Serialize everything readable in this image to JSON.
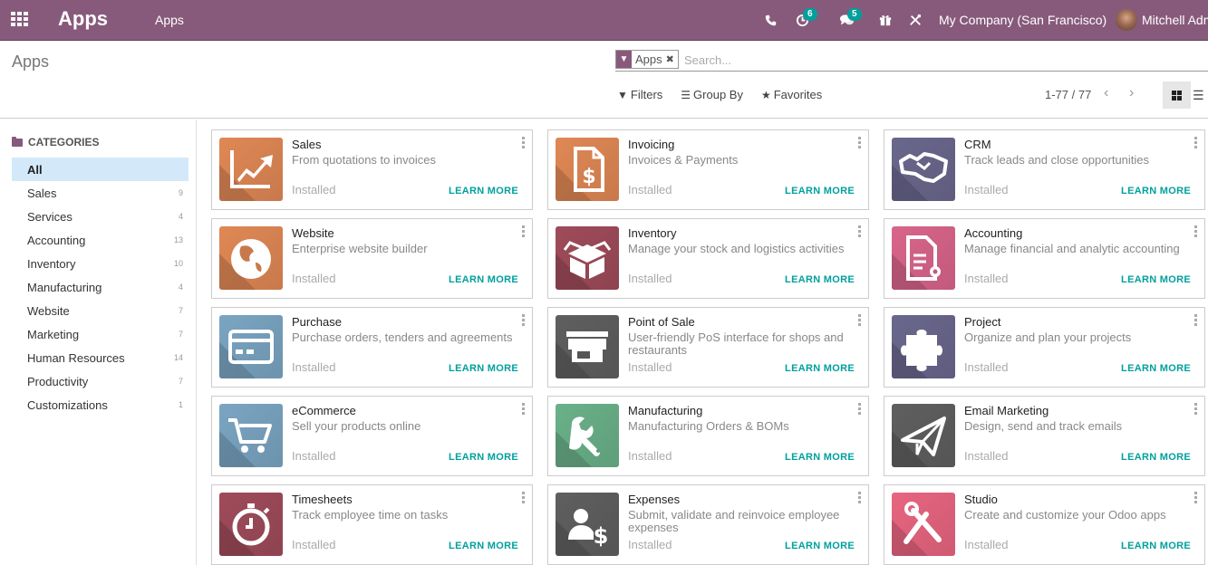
{
  "navbar": {
    "app_name": "Apps",
    "menu_item": "Apps",
    "activity_count": "6",
    "message_count": "5",
    "company": "My Company (San Francisco)",
    "user": "Mitchell Admin"
  },
  "control_panel": {
    "breadcrumb": "Apps",
    "facet_label": "Apps",
    "search_placeholder": "Search...",
    "filters_label": "Filters",
    "group_by_label": "Group By",
    "favorites_label": "Favorites",
    "pager": "1-77 / 77"
  },
  "sidebar": {
    "header": "CATEGORIES",
    "items": [
      {
        "label": "All",
        "count": ""
      },
      {
        "label": "Sales",
        "count": "9"
      },
      {
        "label": "Services",
        "count": "4"
      },
      {
        "label": "Accounting",
        "count": "13"
      },
      {
        "label": "Inventory",
        "count": "10"
      },
      {
        "label": "Manufacturing",
        "count": "4"
      },
      {
        "label": "Website",
        "count": "7"
      },
      {
        "label": "Marketing",
        "count": "7"
      },
      {
        "label": "Human Resources",
        "count": "14"
      },
      {
        "label": "Productivity",
        "count": "7"
      },
      {
        "label": "Customizations",
        "count": "1"
      }
    ]
  },
  "learn_more_label": "LEARN MORE",
  "apps": [
    {
      "name": "Sales",
      "description": "From quotations to invoices",
      "status": "Installed",
      "icon": "chart-arrow-icon",
      "color": "#c8794c"
    },
    {
      "name": "Invoicing",
      "description": "Invoices & Payments",
      "status": "Installed",
      "icon": "invoice-dollar-icon",
      "color": "#c8794c"
    },
    {
      "name": "CRM",
      "description": "Track leads and close opportunities",
      "status": "Installed",
      "icon": "handshake-icon",
      "color": "#5f5c7e"
    },
    {
      "name": "Website",
      "description": "Enterprise website builder",
      "status": "Installed",
      "icon": "globe-icon",
      "color": "#c8794c"
    },
    {
      "name": "Inventory",
      "description": "Manage your stock and logistics activities",
      "status": "Installed",
      "icon": "box-icon",
      "color": "#8e4350"
    },
    {
      "name": "Accounting",
      "description": "Manage financial and analytic accounting",
      "status": "Installed",
      "icon": "document-gear-icon",
      "color": "#c25a7c"
    },
    {
      "name": "Purchase",
      "description": "Purchase orders, tenders and agreements",
      "status": "Installed",
      "icon": "credit-card-icon",
      "color": "#6d93ad"
    },
    {
      "name": "Point of Sale",
      "description": "User-friendly PoS interface for shops and restaurants",
      "status": "Installed",
      "icon": "shop-icon",
      "color": "#555555"
    },
    {
      "name": "Project",
      "description": "Organize and plan your projects",
      "status": "Installed",
      "icon": "puzzle-icon",
      "color": "#5f5c7e"
    },
    {
      "name": "eCommerce",
      "description": "Sell your products online",
      "status": "Installed",
      "icon": "cart-icon",
      "color": "#6d93ad"
    },
    {
      "name": "Manufacturing",
      "description": "Manufacturing Orders & BOMs",
      "status": "Installed",
      "icon": "wrench-icon",
      "color": "#5f9e7a"
    },
    {
      "name": "Email Marketing",
      "description": "Design, send and track emails",
      "status": "Installed",
      "icon": "paper-plane-icon",
      "color": "#555555"
    },
    {
      "name": "Timesheets",
      "description": "Track employee time on tasks",
      "status": "Installed",
      "icon": "stopwatch-icon",
      "color": "#8e4350"
    },
    {
      "name": "Expenses",
      "description": "Submit, validate and reinvoice employee expenses",
      "status": "Installed",
      "icon": "user-dollar-icon",
      "color": "#555555"
    },
    {
      "name": "Studio",
      "description": "Create and customize your Odoo apps",
      "status": "Installed",
      "icon": "tools-icon",
      "color": "#cf5a72"
    }
  ]
}
